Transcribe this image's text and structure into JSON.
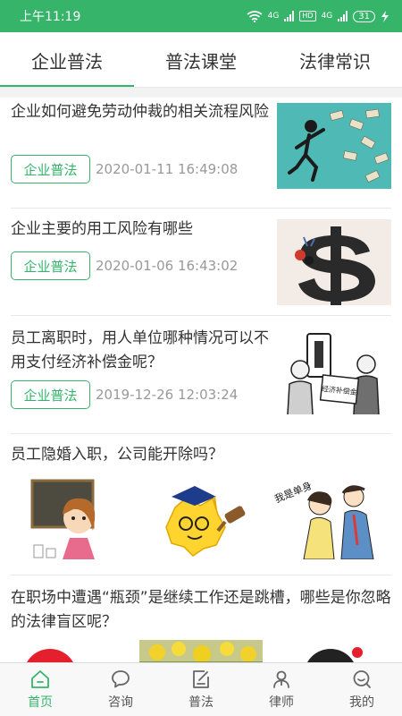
{
  "status": {
    "time": "上午11:19",
    "network1": "4G",
    "network2": "HD",
    "network3": "4G",
    "battery": "31"
  },
  "tabs": [
    {
      "label": "企业普法",
      "active": true
    },
    {
      "label": "普法课堂",
      "active": false
    },
    {
      "label": "法律常识",
      "active": false
    }
  ],
  "articles": [
    {
      "title": "企业如何避免劳动仲裁的相关流程风险",
      "tag": "企业普法",
      "date": "2020-01-11 16:49:08"
    },
    {
      "title": "企业主要的用工风险有哪些",
      "tag": "企业普法",
      "date": "2020-01-06 16:43:02"
    },
    {
      "title": "员工离职时，用人单位哪种情况可以不用支付经济补偿金呢？",
      "tag": "企业普法",
      "date": "2019-12-26 12:03:24",
      "image_text": "经济补偿金"
    },
    {
      "title": "员工隐婚入职，公司能开除吗？",
      "image_text": "我是单身"
    },
    {
      "title": "在职场中遭遇“瓶颈”是继续工作还是跳槽，哪些是你忽略的法律盲区呢？"
    }
  ],
  "nav": [
    {
      "label": "首页",
      "icon": "home-icon",
      "active": true
    },
    {
      "label": "咨询",
      "icon": "chat-bubble-icon",
      "active": false
    },
    {
      "label": "普法",
      "icon": "edit-document-icon",
      "active": false
    },
    {
      "label": "律师",
      "icon": "lawyer-person-icon",
      "active": false
    },
    {
      "label": "我的",
      "icon": "profile-icon",
      "active": false
    }
  ],
  "colors": {
    "accent": "#35b46a",
    "text": "#333333",
    "muted": "#999999"
  }
}
